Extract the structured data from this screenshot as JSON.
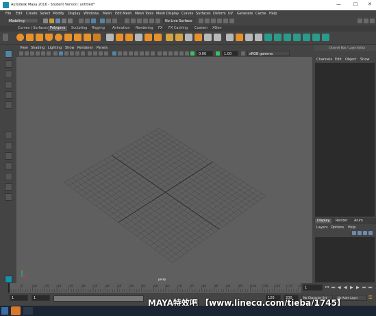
{
  "window": {
    "title": "Autodesk Maya 2016 - Student Version: untitled*",
    "controls": [
      "—",
      "□",
      "✕"
    ]
  },
  "menubar": [
    "File",
    "Edit",
    "Create",
    "Select",
    "Modify",
    "Display",
    "Windows",
    "Mesh",
    "Edit Mesh",
    "Mesh Tools",
    "Mesh Display",
    "Curves",
    "Surfaces",
    "Deform",
    "UV",
    "Generate",
    "Cache",
    "Help"
  ],
  "status": {
    "mode": "Modeling",
    "live_surface": "No Live Surface"
  },
  "shelf_tabs": [
    "Curves / Surfaces",
    "Polygons",
    "Sculpting",
    "Rigging",
    "Animation",
    "Rendering",
    "FX",
    "FX Caching",
    "Custom",
    "XGen"
  ],
  "shelf_active": "Polygons",
  "viewport": {
    "menu": [
      "View",
      "Shading",
      "Lighting",
      "Show",
      "Renderer",
      "Panels"
    ],
    "near_clip": "0.00",
    "far_clip": "1.00",
    "color_space": "sRGB gamma",
    "camera_label": "persp"
  },
  "channel_box": {
    "header": "Channel Box / Layer Editor",
    "menu": [
      "Channels",
      "Edit",
      "Object",
      "Show"
    ]
  },
  "layer_editor": {
    "tabs": [
      "Display",
      "Render",
      "Anim"
    ],
    "active_tab": "Display",
    "menu": [
      "Layers",
      "Options",
      "Help"
    ]
  },
  "timeline": {
    "ticks": [
      "5",
      "10",
      "15",
      "20",
      "25",
      "30",
      "35",
      "40",
      "45",
      "50",
      "55",
      "60",
      "65",
      "70",
      "75",
      "80",
      "85",
      "90",
      "95",
      "100",
      "105",
      "110",
      "115",
      "120"
    ],
    "current_frame": "1",
    "range_start": "1",
    "range_inner_start": "1",
    "range_end": "120",
    "range_end_outer": "120",
    "anim_end": "200",
    "char_set": "No Character Set",
    "anim_layer": "No Anim Layer"
  },
  "watermark": "MAYA特效吧 【www.linecg.com/tieba/1745】",
  "colors": {
    "accent": "#5285a6",
    "viewport_bg": "#5f5f5f",
    "panel_bg": "#444444",
    "shelf_orange": "#e8902a",
    "shelf_teal": "#2a9a8a"
  }
}
